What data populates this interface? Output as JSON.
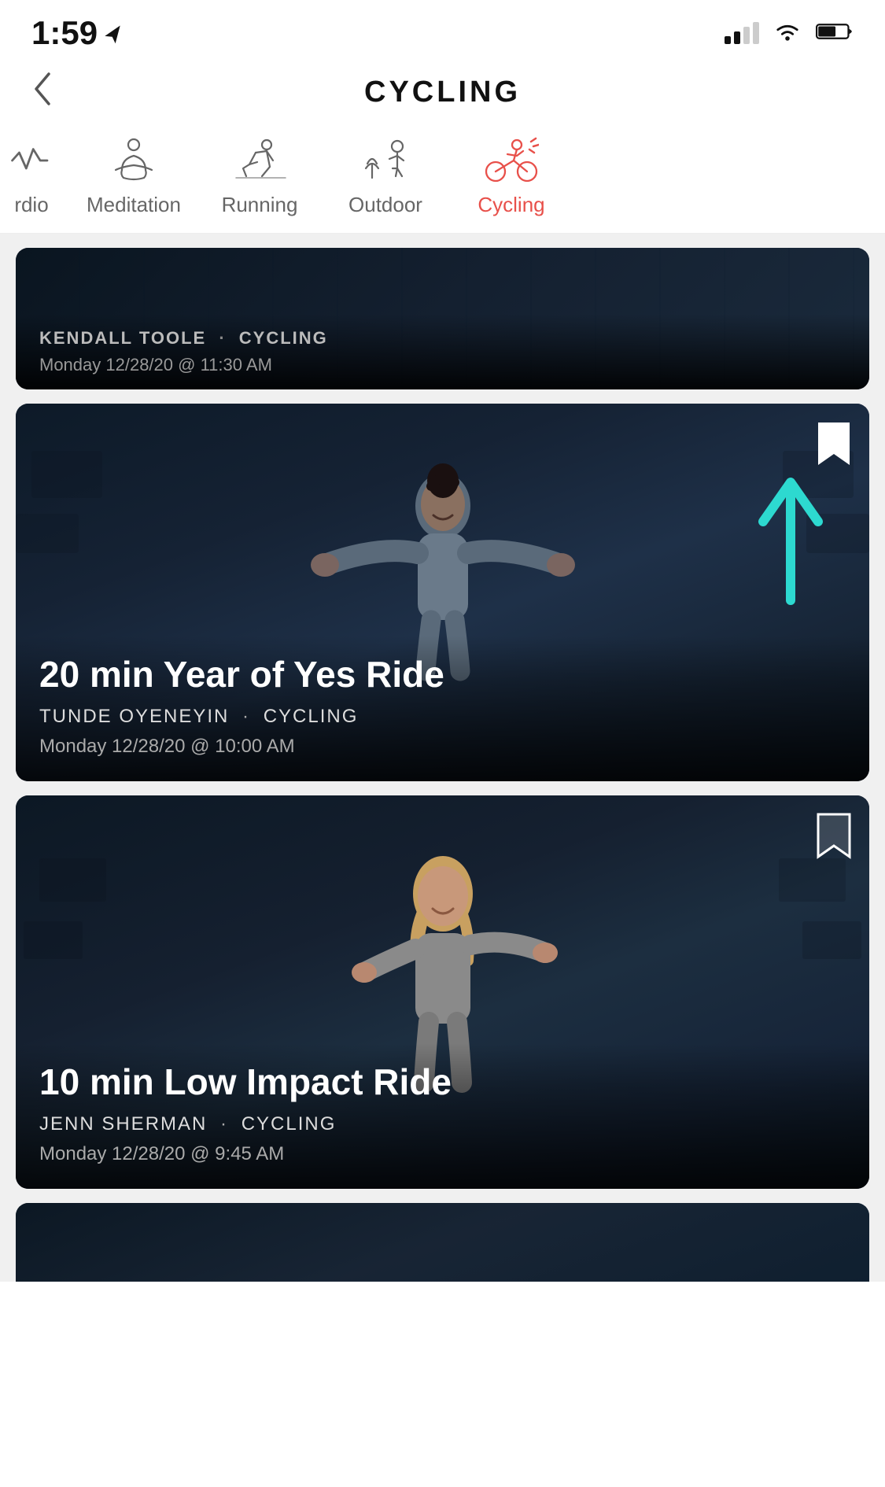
{
  "statusBar": {
    "time": "1:59",
    "locationArrow": true
  },
  "header": {
    "backLabel": "<",
    "title": "CYCLING"
  },
  "tabs": [
    {
      "id": "cardio",
      "label": "rdio",
      "icon": "cardio-icon",
      "active": false,
      "partial": true
    },
    {
      "id": "meditation",
      "label": "Meditation",
      "icon": "meditation-icon",
      "active": false
    },
    {
      "id": "running",
      "label": "Running",
      "icon": "running-icon",
      "active": false
    },
    {
      "id": "outdoor",
      "label": "Outdoor",
      "icon": "outdoor-icon",
      "active": false
    },
    {
      "id": "cycling",
      "label": "Cycling",
      "icon": "cycling-icon",
      "active": true
    }
  ],
  "cards": [
    {
      "id": "card-kendall",
      "title": "",
      "instructor": "KENDALL TOOLE",
      "category": "CYCLING",
      "datetime": "Monday 12/28/20 @ 11:30 AM",
      "partial": true,
      "bookmarked": false
    },
    {
      "id": "card-tunde",
      "title": "20 min Year of Yes Ride",
      "instructor": "TUNDE OYENEYIN",
      "category": "CYCLING",
      "datetime": "Monday 12/28/20 @ 10:00 AM",
      "partial": false,
      "bookmarked": true,
      "hasArrow": true
    },
    {
      "id": "card-jenn",
      "title": "10 min Low Impact Ride",
      "instructor": "JENN SHERMAN",
      "category": "CYCLING",
      "datetime": "Monday 12/28/20 @ 9:45 AM",
      "partial": false,
      "bookmarked": false
    }
  ],
  "bottomCard": {
    "partial": true
  },
  "colors": {
    "accent": "#e8504a",
    "activeTab": "#e8504a",
    "bookmarkActive": "#ffffff",
    "arrowColor": "#2dd9d0",
    "cardBg": "#1a2035"
  }
}
